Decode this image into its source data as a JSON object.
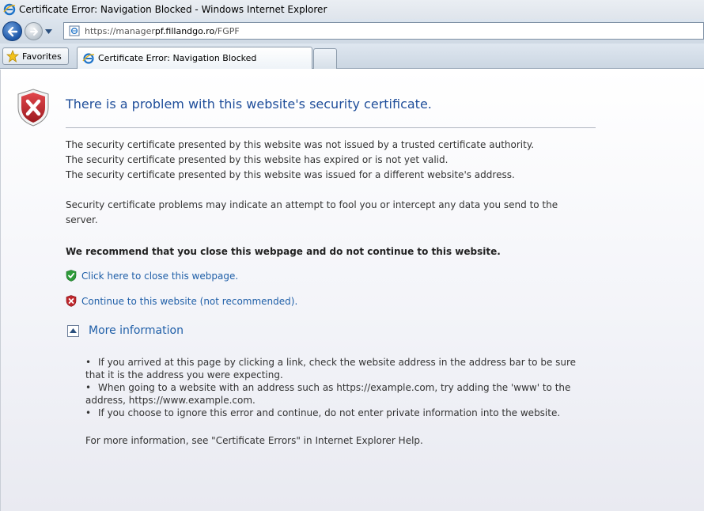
{
  "window": {
    "title": "Certificate Error: Navigation Blocked - Windows Internet Explorer"
  },
  "address_bar": {
    "url_prefix": "https://manager",
    "url_host": "pf.fillandgo.ro",
    "url_suffix": "/FGPF"
  },
  "toolbar": {
    "favorites_label": "Favorites"
  },
  "tabs": [
    {
      "label": "Certificate Error: Navigation Blocked",
      "active": true
    }
  ],
  "page": {
    "title": "There is a problem with this website's security certificate.",
    "reasons": [
      "The security certificate presented by this website was not issued by a trusted certificate authority.",
      "The security certificate presented by this website has expired or is not yet valid.",
      "The security certificate presented by this website was issued for a different website's address."
    ],
    "warning_line1": "Security certificate problems may indicate an attempt to fool you or intercept any data you send to the",
    "warning_line2": "server.",
    "recommendation": "We recommend that you close this webpage and do not continue to this website.",
    "close_link": "Click here to close this webpage.",
    "continue_link": "Continue to this website (not recommended).",
    "more_info_label": "More information",
    "bullets": [
      {
        "line1": "If you arrived at this page by clicking a link, check the website address in the address bar to be sure",
        "line2": "that it is the address you were expecting."
      },
      {
        "line1": "When going to a website with an address such as https://example.com, try adding the 'www' to the",
        "line2": "address, https://www.example.com."
      },
      {
        "line1": "If you choose to ignore this error and continue, do not enter private information into the website.",
        "line2": ""
      }
    ],
    "help_note": "For more information, see \"Certificate Errors\" in Internet Explorer Help."
  },
  "colors": {
    "link": "#1f5fa8",
    "title": "#1f4e9a",
    "error_red": "#c0272d",
    "ok_green": "#2e9b3a"
  }
}
